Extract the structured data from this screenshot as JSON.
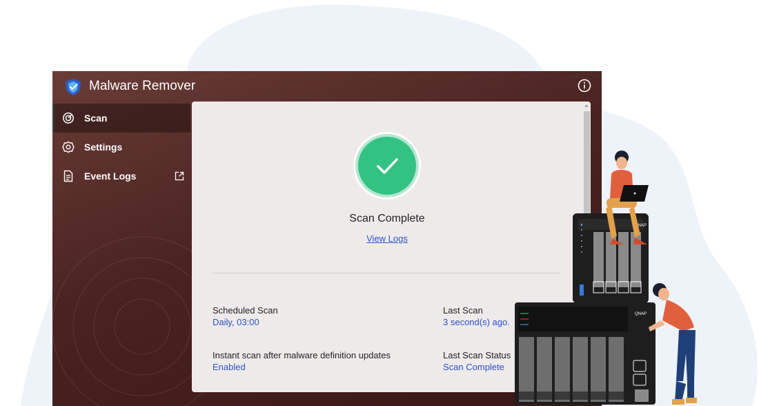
{
  "app": {
    "title": "Malware Remover",
    "logo_icon": "shield-logo-icon",
    "info_icon": "info-icon"
  },
  "sidebar": {
    "items": [
      {
        "label": "Scan",
        "icon": "radar-icon",
        "active": true
      },
      {
        "label": "Settings",
        "icon": "gear-icon",
        "active": false
      },
      {
        "label": "Event Logs",
        "icon": "document-icon",
        "active": false,
        "trailing_icon": "external-link-icon"
      }
    ]
  },
  "status": {
    "title": "Scan Complete",
    "link": "View Logs",
    "icon": "check-icon"
  },
  "details": {
    "scheduled_scan": {
      "label": "Scheduled Scan",
      "value": "Daily, 03:00"
    },
    "last_scan": {
      "label": "Last Scan",
      "value": "3 second(s) ago."
    },
    "instant_scan": {
      "label": "Instant scan after malware definition updates",
      "value": "Enabled"
    },
    "last_scan_status": {
      "label": "Last Scan Status",
      "value": "Scan Complete"
    }
  },
  "illustration": {
    "nas_brand": "QNAP"
  },
  "colors": {
    "header_bg": "#5c302c",
    "panel_bg": "#eeeaea",
    "accent_green": "#2fb87c",
    "link_blue": "#2a52c9"
  }
}
